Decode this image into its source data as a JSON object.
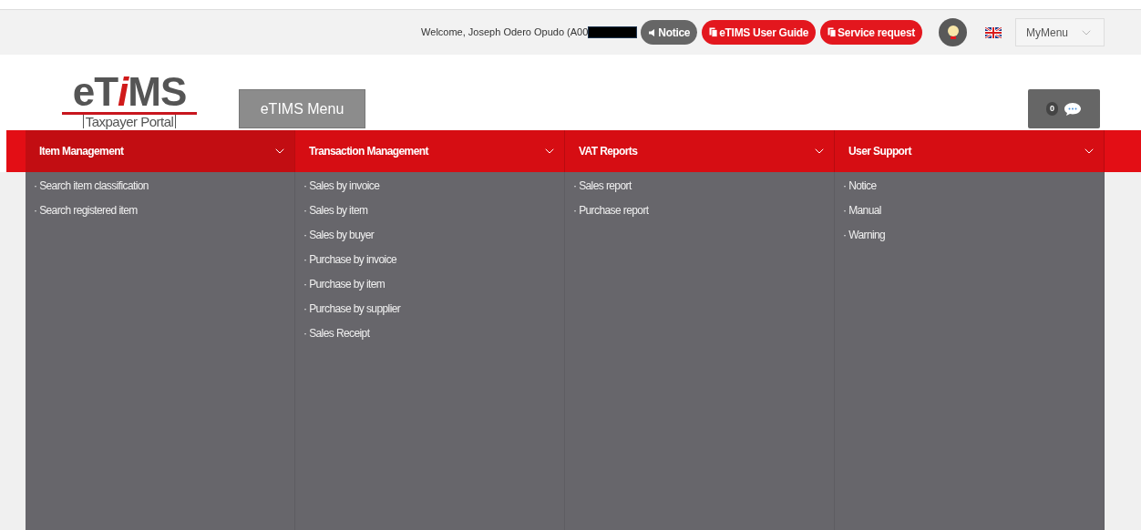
{
  "top_bar": {
    "welcome": "Welcome, Joseph Odero Opudo (A00",
    "redacted": true,
    "buttons": [
      {
        "label": "Notice",
        "kind": "dark"
      },
      {
        "label": "eTIMS User Guide",
        "kind": "red"
      },
      {
        "label": "Service request",
        "kind": "red"
      }
    ],
    "my_menu": "MyMenu"
  },
  "logo": {
    "title_parts": [
      {
        "text": "eT",
        "accent": false
      },
      {
        "text": "i",
        "accent": true
      },
      {
        "text": "MS",
        "accent": false
      }
    ],
    "subtitle": "Taxpayer Portal"
  },
  "menu_button": "eTIMS Menu",
  "messages": {
    "count": "0"
  },
  "menu": [
    {
      "title": "Item Management",
      "selected": true,
      "items": [
        "· Search item classification",
        "· Search registered item"
      ]
    },
    {
      "title": "Transaction Management",
      "selected": false,
      "items": [
        "· Sales by invoice",
        "· Sales by item",
        "· Sales by buyer",
        "· Purchase by invoice",
        "· Purchase by item",
        "· Purchase by supplier",
        "· Sales Receipt"
      ]
    },
    {
      "title": "VAT Reports",
      "selected": false,
      "items": [
        "· Sales report",
        "· Purchase report"
      ]
    },
    {
      "title": "User Support",
      "selected": false,
      "items": [
        "· Notice",
        "· Manual",
        "· Warning"
      ]
    }
  ]
}
